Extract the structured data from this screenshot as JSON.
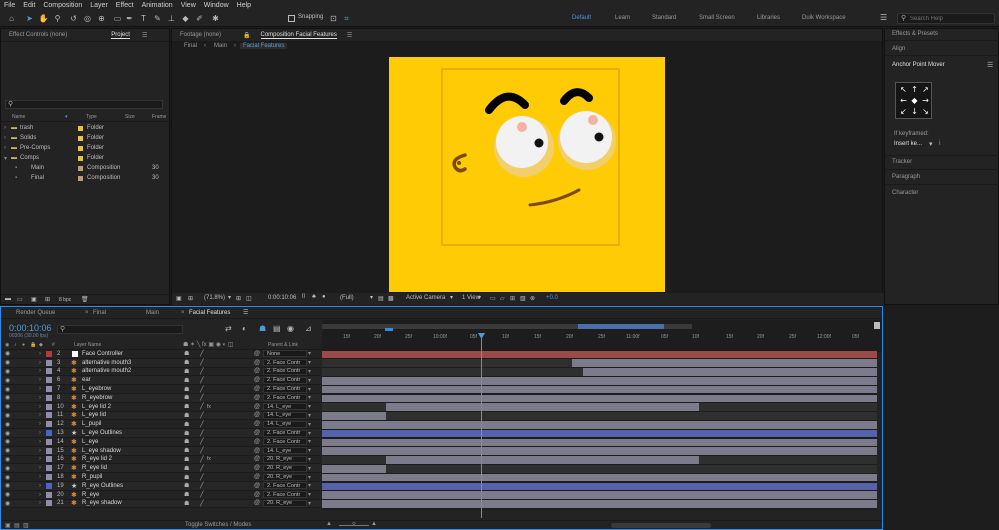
{
  "menu": [
    "File",
    "Edit",
    "Composition",
    "Layer",
    "Effect",
    "Animation",
    "View",
    "Window",
    "Help"
  ],
  "toolbar": {
    "snapping_label": "Snapping"
  },
  "workspaces": [
    "Default",
    "Learn",
    "Standard",
    "Small Screen",
    "Libraries",
    "Duik Workspace"
  ],
  "search": {
    "placeholder": "Search Help"
  },
  "left_panel": {
    "tabs": [
      "Effect Controls (none)",
      "Project"
    ],
    "columns": [
      "Name",
      "Type",
      "Size",
      "Frame"
    ],
    "items": [
      {
        "name": "trash",
        "type": "Folder",
        "size": "",
        "color": "#e6c34a"
      },
      {
        "name": "Solids",
        "type": "Folder",
        "size": "",
        "color": "#e6c34a"
      },
      {
        "name": "Pre-Comps",
        "type": "Folder",
        "size": "",
        "color": "#e6c34a"
      },
      {
        "name": "Comps",
        "type": "Folder",
        "size": "",
        "color": "#e6c34a"
      },
      {
        "name": "Main",
        "type": "Composition",
        "size": "30",
        "color": "#b7a07a"
      },
      {
        "name": "Final",
        "type": "Composition",
        "size": "30",
        "color": "#b7a07a"
      }
    ],
    "bpc": "8 bpc"
  },
  "viewer": {
    "footage_tab": "Footage (none)",
    "composition_tab": "Composition Facial Features",
    "breadcrumbs": [
      "Final",
      "Main",
      "Facial Features"
    ],
    "zoom": "(71.8%)",
    "timecode": "0:00:10:06",
    "resolution": "(Full)",
    "camera": "Active Camera",
    "view": "1 View",
    "exposure": "+0.0",
    "face_color": "#ffcb05"
  },
  "right_panel": {
    "effects_presets": "Effects & Presets",
    "align": "Align",
    "anchor_point_mover": "Anchor Point Mover",
    "if_keyframed": "If keyframed:",
    "insert_option": "Insert ke...",
    "tracker": "Tracker",
    "paragraph": "Paragraph",
    "character": "Character"
  },
  "timeline": {
    "tabs": [
      "Render Queue",
      "Final",
      "Main",
      "Facial Features"
    ],
    "current_time": "0:00:10:06",
    "fps_info": "00306 (30.00 fps)",
    "columns": [
      "Layer Name",
      "Parent & Link"
    ],
    "ruler": [
      "15f",
      "20f",
      "25f",
      "10:00f",
      "05f",
      "10f",
      "15f",
      "20f",
      "25f",
      "11:00f",
      "05f",
      "10f",
      "15f",
      "20f",
      "25f",
      "12:00f",
      "05f"
    ],
    "footer": "Toggle Switches / Modes",
    "layers": [
      {
        "num": "2",
        "name": "Face Controller",
        "parent": "None",
        "color": "#b33a3a",
        "fx": false,
        "bar_start": 0,
        "bar_end": 1,
        "bar_color": "#9b4a4a",
        "label_color": "#b33a3a",
        "icon": "solid"
      },
      {
        "num": "3",
        "name": "alternative mouth3",
        "parent": "2. Face Contr",
        "color": "#8e8ea8",
        "fx": false,
        "bar_start": 0.45,
        "bar_end": 1,
        "bar_color": "#7b7b8c",
        "label_color": "#8e8ea8",
        "icon": "shape"
      },
      {
        "num": "4",
        "name": "alternative mouth2",
        "parent": "2. Face Contr",
        "color": "#8e8ea8",
        "fx": false,
        "bar_start": 0.47,
        "bar_end": 1,
        "bar_color": "#7b7b8c",
        "label_color": "#8e8ea8",
        "icon": "shape"
      },
      {
        "num": "6",
        "name": "ear",
        "parent": "2. Face Contr",
        "color": "#8e8ea8",
        "fx": false,
        "bar_start": 0,
        "bar_end": 1,
        "bar_color": "#7b7b8c",
        "label_color": "#8e8ea8",
        "icon": "shape"
      },
      {
        "num": "7",
        "name": "L_eyebrow",
        "parent": "2. Face Contr",
        "color": "#8e8ea8",
        "fx": false,
        "bar_start": 0,
        "bar_end": 1,
        "bar_color": "#7b7b8c",
        "label_color": "#8e8ea8",
        "icon": "shape"
      },
      {
        "num": "8",
        "name": "R_eyebrow",
        "parent": "2. Face Contr",
        "color": "#8e8ea8",
        "fx": false,
        "bar_start": 0,
        "bar_end": 1,
        "bar_color": "#7b7b8c",
        "label_color": "#8e8ea8",
        "icon": "shape"
      },
      {
        "num": "10",
        "name": "L_eye lid 2",
        "parent": "14. L_eye",
        "color": "#8e8ea8",
        "fx": true,
        "bar_start": 0.115,
        "bar_end": 0.68,
        "bar_color": "#7b7b8c",
        "label_color": "#8e8ea8",
        "icon": "shape"
      },
      {
        "num": "11",
        "name": "L_eye lid",
        "parent": "14. L_eye",
        "color": "#8e8ea8",
        "fx": false,
        "bar_start": 0,
        "bar_end": 0.115,
        "bar_color": "#7b7b8c",
        "label_color": "#8e8ea8",
        "icon": "shape"
      },
      {
        "num": "12",
        "name": "L_pupil",
        "parent": "14. L_eye",
        "color": "#8e8ea8",
        "fx": false,
        "bar_start": 0,
        "bar_end": 1,
        "bar_color": "#7b7b8c",
        "label_color": "#8e8ea8",
        "icon": "shape"
      },
      {
        "num": "13",
        "name": "L_eye Outlines",
        "parent": "2. Face Contr",
        "color": "#4b63c6",
        "fx": false,
        "bar_start": 0,
        "bar_end": 1,
        "bar_color": "#5561a8",
        "label_color": "#4b63c6",
        "icon": "star"
      },
      {
        "num": "14",
        "name": "L_eye",
        "parent": "2. Face Contr",
        "color": "#8e8ea8",
        "fx": false,
        "bar_start": 0,
        "bar_end": 1,
        "bar_color": "#7b7b8c",
        "label_color": "#8e8ea8",
        "icon": "shape"
      },
      {
        "num": "15",
        "name": "L_eye shadow",
        "parent": "14. L_eye",
        "color": "#8e8ea8",
        "fx": false,
        "bar_start": 0,
        "bar_end": 1,
        "bar_color": "#7b7b8c",
        "label_color": "#8e8ea8",
        "icon": "shape"
      },
      {
        "num": "16",
        "name": "R_eye lid 2",
        "parent": "20. R_eye",
        "color": "#8e8ea8",
        "fx": true,
        "bar_start": 0.115,
        "bar_end": 0.68,
        "bar_color": "#7b7b8c",
        "label_color": "#8e8ea8",
        "icon": "shape"
      },
      {
        "num": "17",
        "name": "R_eye lid",
        "parent": "20. R_eye",
        "color": "#8e8ea8",
        "fx": false,
        "bar_start": 0,
        "bar_end": 0.115,
        "bar_color": "#7b7b8c",
        "label_color": "#8e8ea8",
        "icon": "shape"
      },
      {
        "num": "18",
        "name": "R_pupil",
        "parent": "20. R_eye",
        "color": "#8e8ea8",
        "fx": false,
        "bar_start": 0,
        "bar_end": 1,
        "bar_color": "#7b7b8c",
        "label_color": "#8e8ea8",
        "icon": "shape"
      },
      {
        "num": "19",
        "name": "R_eye Outlines",
        "parent": "2. Face Contr",
        "color": "#4b63c6",
        "fx": false,
        "bar_start": 0,
        "bar_end": 1,
        "bar_color": "#5561a8",
        "label_color": "#4b63c6",
        "icon": "star"
      },
      {
        "num": "20",
        "name": "R_eye",
        "parent": "2. Face Contr",
        "color": "#8e8ea8",
        "fx": false,
        "bar_start": 0,
        "bar_end": 1,
        "bar_color": "#7b7b8c",
        "label_color": "#8e8ea8",
        "icon": "shape"
      },
      {
        "num": "21",
        "name": "R_eye shadow",
        "parent": "20. R_eye",
        "color": "#8e8ea8",
        "fx": false,
        "bar_start": 0,
        "bar_end": 1,
        "bar_color": "#7b7b8c",
        "label_color": "#8e8ea8",
        "icon": "shape"
      }
    ]
  },
  "colors": {
    "accent": "#2d8ceb",
    "playhead": "#4f9ad8"
  }
}
